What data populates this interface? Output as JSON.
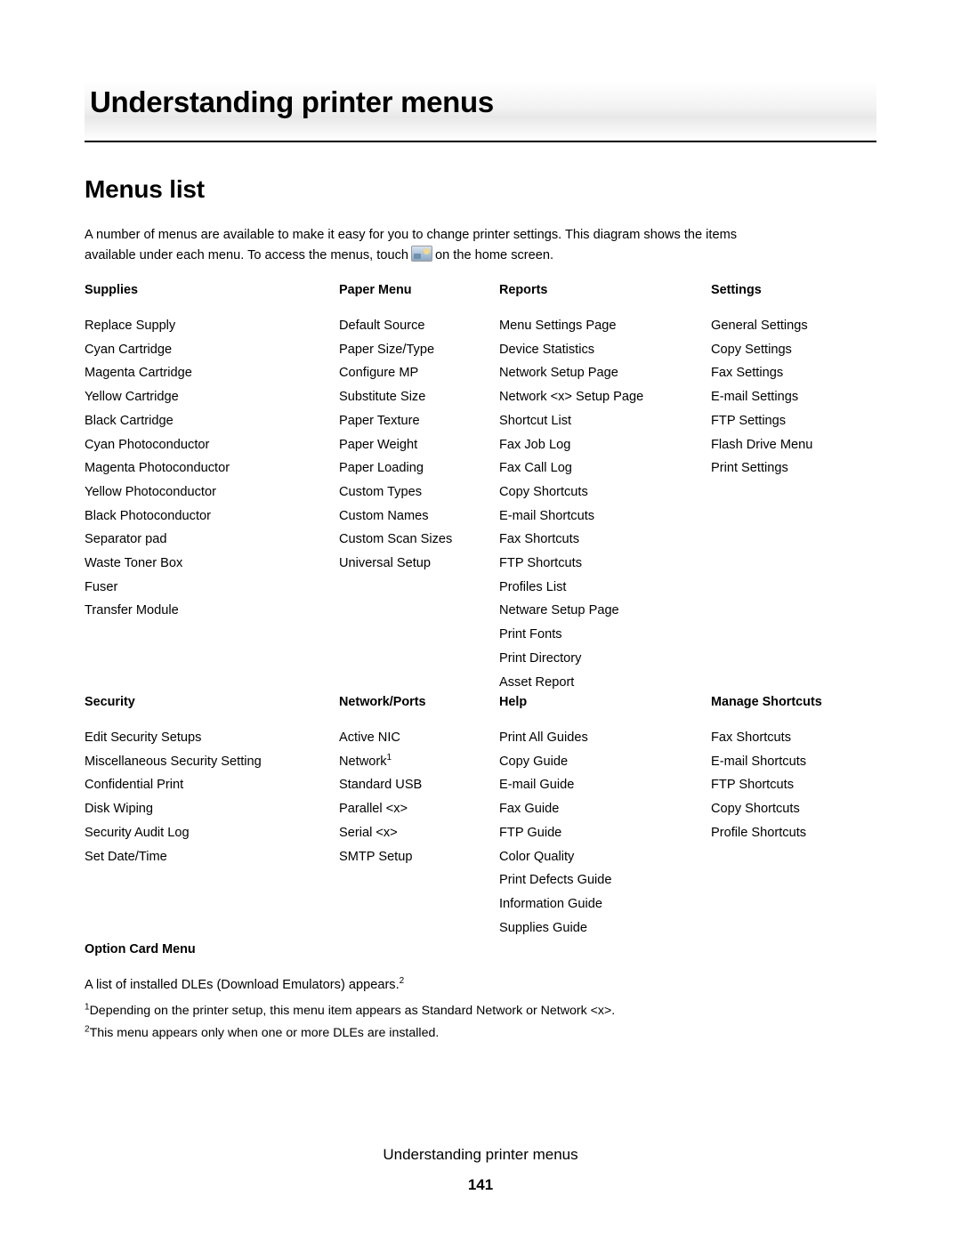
{
  "chapter": {
    "title": "Understanding printer menus"
  },
  "section": {
    "heading": "Menus list",
    "intro_line1": "A number of menus are available to make it easy for you to change printer settings. This diagram shows the items",
    "intro_line2a": "available under each menu. To access the menus, touch",
    "intro_line2b": "on the home screen.",
    "touch_icon_name": "home-menus-icon"
  },
  "columns": [
    {
      "heading": "Supplies",
      "items": [
        "Replace Supply",
        "Cyan Cartridge",
        "Magenta Cartridge",
        "Yellow Cartridge",
        "Black Cartridge",
        "Cyan Photoconductor",
        "Magenta Photoconductor",
        "Yellow Photoconductor",
        "Black Photoconductor",
        "Separator pad",
        "Waste Toner Box",
        "Fuser",
        "Transfer Module"
      ]
    },
    {
      "heading": "Paper Menu",
      "items": [
        "Default Source",
        "Paper Size/Type",
        "Configure MP",
        "Substitute Size",
        "Paper Texture",
        "Paper Weight",
        "Paper Loading",
        "Custom Types",
        "Custom Names",
        "Custom Scan Sizes",
        "Universal Setup"
      ]
    },
    {
      "heading": "Reports",
      "items": [
        "Menu Settings Page",
        "Device Statistics",
        "Network Setup Page",
        "Network <x> Setup Page",
        "Shortcut List",
        "Fax Job Log",
        "Fax Call Log",
        "Copy Shortcuts",
        "E-mail Shortcuts",
        "Fax Shortcuts",
        "FTP Shortcuts",
        "Profiles List",
        "Netware Setup Page",
        "Print Fonts",
        "Print Directory",
        "Asset Report"
      ]
    },
    {
      "heading": "Settings",
      "items": [
        "General Settings",
        "Copy Settings",
        "Fax Settings",
        "E-mail Settings",
        "FTP Settings",
        "Flash Drive Menu",
        "Print Settings"
      ]
    },
    {
      "heading": "Security",
      "items": [
        "Edit Security Setups",
        "Miscellaneous Security Setting",
        "Confidential Print",
        "Disk Wiping",
        "Security Audit Log",
        "Set Date/Time"
      ]
    },
    {
      "heading": "Network/Ports",
      "items": [
        "Active NIC",
        "Network",
        "Standard USB",
        "Parallel <x>",
        "Serial <x>",
        "SMTP Setup"
      ],
      "network_superscript": "1"
    },
    {
      "heading": "Help",
      "items": [
        "Print All Guides",
        "Copy Guide",
        "E-mail Guide",
        "Fax Guide",
        "FTP Guide",
        "Color Quality",
        "Print Defects Guide",
        "Information Guide",
        "Supplies Guide"
      ]
    },
    {
      "heading": "Manage Shortcuts",
      "items": [
        "Fax Shortcuts",
        "E-mail Shortcuts",
        "FTP Shortcuts",
        "Copy Shortcuts",
        "Profile Shortcuts"
      ]
    }
  ],
  "option_card": {
    "heading": "Option Card Menu",
    "text": "A list of installed DLEs (Download Emulators) appears.",
    "superscript": "2"
  },
  "footnotes": [
    {
      "marker": "1",
      "text": "Depending on the printer setup, this menu item appears as Standard Network or Network <x>."
    },
    {
      "marker": "2",
      "text": "This menu appears only when one or more DLEs are installed."
    }
  ],
  "footer": {
    "title": "Understanding printer menus",
    "page_number": "141"
  }
}
